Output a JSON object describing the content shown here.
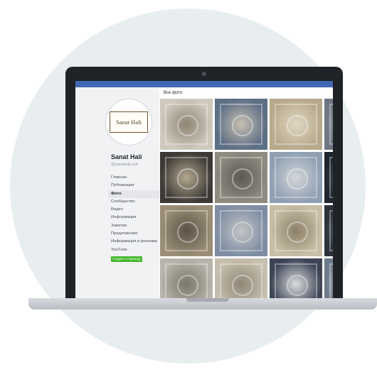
{
  "logo_text": "Sanat Hali",
  "page": {
    "name": "Sanat Hali",
    "handle": "@sanathali.ucb"
  },
  "nav": [
    {
      "label": "Главная",
      "active": false
    },
    {
      "label": "Публикации",
      "active": false
    },
    {
      "label": "Фото",
      "active": true
    },
    {
      "label": "Сообщество",
      "active": false
    },
    {
      "label": "Видео",
      "active": false
    },
    {
      "label": "Информация",
      "active": false
    },
    {
      "label": "Заметки",
      "active": false
    },
    {
      "label": "Предложения",
      "active": false
    },
    {
      "label": "Информация и реклама",
      "active": false
    },
    {
      "label": "YouTube",
      "active": false
    }
  ],
  "follow_button": "Создать Страницу",
  "content_title": "Все фото",
  "photos": [
    {
      "name": "rug-photo-1",
      "colors": [
        "#cfc9bd",
        "#8e8473"
      ]
    },
    {
      "name": "rug-photo-2",
      "colors": [
        "#5d6f85",
        "#c7c0b2"
      ]
    },
    {
      "name": "rug-photo-3",
      "colors": [
        "#b7a98b",
        "#e1d7c2"
      ]
    },
    {
      "name": "rug-photo-4",
      "colors": [
        "#6d7682",
        "#b6bac0"
      ]
    },
    {
      "name": "rug-photo-5",
      "colors": [
        "#3d3a36",
        "#b5a890"
      ]
    },
    {
      "name": "rug-photo-6",
      "colors": [
        "#8e8a80",
        "#5c5952"
      ]
    },
    {
      "name": "rug-photo-7",
      "colors": [
        "#8fa0b3",
        "#d4d6d8"
      ]
    },
    {
      "name": "rug-photo-8",
      "colors": [
        "#1e2630",
        "#6a727c"
      ]
    },
    {
      "name": "rug-photo-9",
      "colors": [
        "#9a8e76",
        "#5b5246"
      ]
    },
    {
      "name": "rug-photo-10",
      "colors": [
        "#7f8ea3",
        "#c3c5c6"
      ]
    },
    {
      "name": "rug-photo-11",
      "colors": [
        "#c9bea6",
        "#8c8069"
      ]
    },
    {
      "name": "rug-photo-12",
      "colors": [
        "#2b323c",
        "#7c858f"
      ]
    },
    {
      "name": "rug-photo-13",
      "colors": [
        "#b8b4ab",
        "#7a7569"
      ]
    },
    {
      "name": "rug-photo-14",
      "colors": [
        "#c7bfae",
        "#8f8675"
      ]
    },
    {
      "name": "rug-photo-15",
      "colors": [
        "#3c4454",
        "#dcdde0"
      ]
    },
    {
      "name": "rug-photo-16",
      "colors": [
        "#6e7a8a",
        "#c5c8cc"
      ]
    }
  ]
}
